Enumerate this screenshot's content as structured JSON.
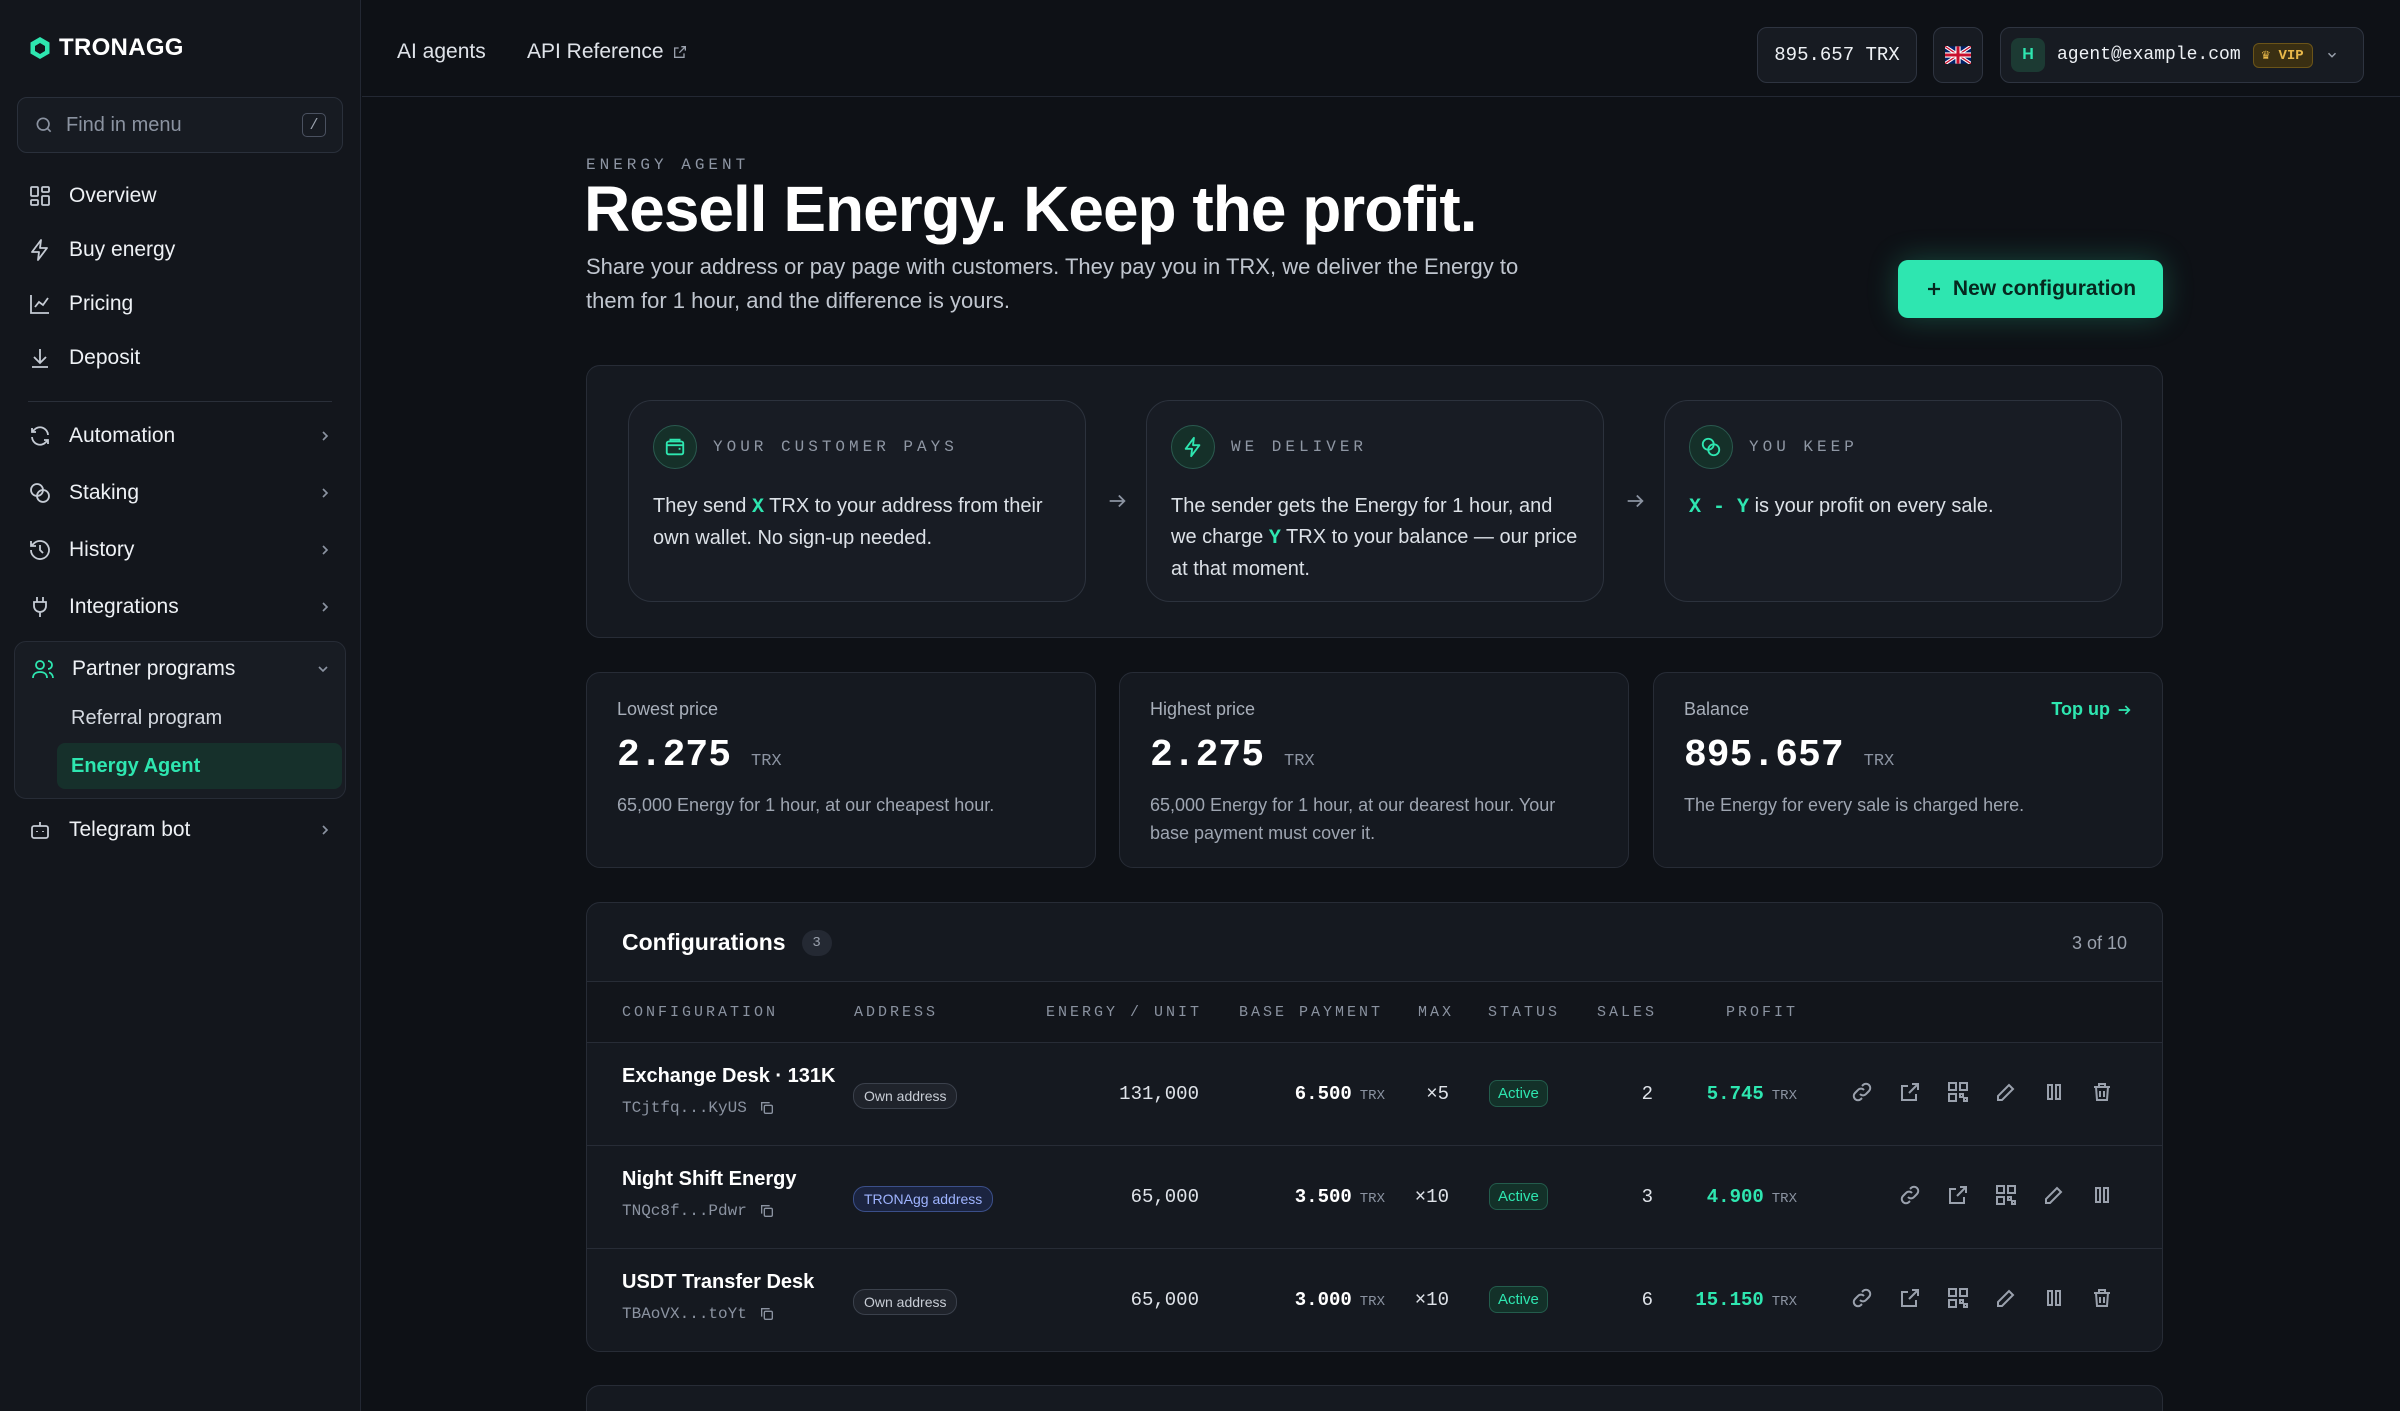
{
  "brand": {
    "name": "TRONAGG",
    "accent": "#2ee6b0"
  },
  "sidebar": {
    "search_placeholder": "Find in menu",
    "search_shortcut": "/",
    "primary": [
      {
        "label": "Overview",
        "icon": "grid-icon"
      },
      {
        "label": "Buy energy",
        "icon": "bolt-icon"
      },
      {
        "label": "Pricing",
        "icon": "chart-icon"
      },
      {
        "label": "Deposit",
        "icon": "download-icon"
      }
    ],
    "groups": [
      {
        "label": "Automation",
        "icon": "refresh-icon"
      },
      {
        "label": "Staking",
        "icon": "coins-icon"
      },
      {
        "label": "History",
        "icon": "history-icon"
      },
      {
        "label": "Integrations",
        "icon": "plug-icon"
      }
    ],
    "partner": {
      "label": "Partner programs",
      "children": [
        "Referral program",
        "Energy Agent"
      ],
      "active": "Energy Agent"
    },
    "telegram": {
      "label": "Telegram bot"
    }
  },
  "topbar": {
    "links": [
      "AI agents",
      "API Reference"
    ],
    "balance": "895.657 TRX",
    "language": "en-GB",
    "avatar_initial": "H",
    "email": "agent@example.com",
    "vip_label": "VIP"
  },
  "hero": {
    "eyebrow": "ENERGY AGENT",
    "title": "Resell Energy. Keep the profit.",
    "subtitle": "Share your address or pay page with customers. They pay you in TRX, we deliver the Energy to them for 1 hour, and the difference is yours.",
    "new_button": "New configuration"
  },
  "flow": [
    {
      "title": "YOUR CUSTOMER PAYS",
      "pre": "They send ",
      "var": "X",
      "post": " TRX to your address from their own wallet. No sign-up needed."
    },
    {
      "title": "WE DELIVER",
      "pre": "The sender gets the Energy for 1 hour, and we charge ",
      "var": "Y",
      "post": " TRX to your balance — our price at that moment."
    },
    {
      "title": "YOU KEEP",
      "pre": "",
      "var": "X - Y",
      "post": " is your profit on every sale."
    }
  ],
  "stats": {
    "lowest": {
      "label": "Lowest price",
      "value": "2.275",
      "unit": "TRX",
      "desc": "65,000 Energy for 1 hour, at our cheapest hour."
    },
    "highest": {
      "label": "Highest price",
      "value": "2.275",
      "unit": "TRX",
      "desc": "65,000 Energy for 1 hour, at our dearest hour. Your base payment must cover it."
    },
    "balance": {
      "label": "Balance",
      "value": "895.657",
      "unit": "TRX",
      "desc": "The Energy for every sale is charged here.",
      "action": "Top up"
    }
  },
  "configs": {
    "title": "Configurations",
    "count": "3",
    "pager": "3 of 10",
    "columns": [
      "CONFIGURATION",
      "ADDRESS",
      "ENERGY / UNIT",
      "BASE PAYMENT",
      "MAX",
      "STATUS",
      "SALES",
      "PROFIT"
    ],
    "rows": [
      {
        "name": "Exchange Desk · 131K",
        "addr": "TCjtfq...KyUS",
        "type": "Own address",
        "energy": "131,000",
        "base": "6.500",
        "unit": "TRX",
        "max": "×5",
        "status": "Active",
        "sales": "2",
        "profit": "5.745"
      },
      {
        "name": "Night Shift Energy",
        "addr": "TNQc8f...Pdwr",
        "type": "TRONAgg address",
        "energy": "65,000",
        "base": "3.500",
        "unit": "TRX",
        "max": "×10",
        "status": "Active",
        "sales": "3",
        "profit": "4.900"
      },
      {
        "name": "USDT Transfer Desk",
        "addr": "TBAoVX...toYt",
        "type": "Own address",
        "energy": "65,000",
        "base": "3.000",
        "unit": "TRX",
        "max": "×10",
        "status": "Active",
        "sales": "6",
        "profit": "15.150"
      }
    ]
  }
}
